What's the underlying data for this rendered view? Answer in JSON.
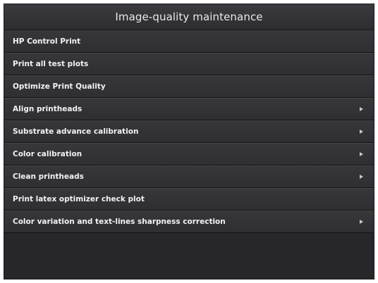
{
  "header": {
    "title": "Image-quality maintenance"
  },
  "menu": {
    "items": [
      {
        "label": "HP Control Print",
        "has_submenu": false
      },
      {
        "label": "Print all test plots",
        "has_submenu": false
      },
      {
        "label": "Optimize Print Quality",
        "has_submenu": false
      },
      {
        "label": "Align printheads",
        "has_submenu": true
      },
      {
        "label": "Substrate advance calibration",
        "has_submenu": true
      },
      {
        "label": "Color calibration",
        "has_submenu": true
      },
      {
        "label": "Clean printheads",
        "has_submenu": true
      },
      {
        "label": "Print latex optimizer check plot",
        "has_submenu": false
      },
      {
        "label": "Color variation and text-lines sharpness correction",
        "has_submenu": true
      }
    ]
  },
  "icons": {
    "submenu_indicator": "chevron-right-icon"
  },
  "colors": {
    "background": "#27272b",
    "item_text": "#f2f2f4",
    "title_text": "#e9e9ec"
  }
}
